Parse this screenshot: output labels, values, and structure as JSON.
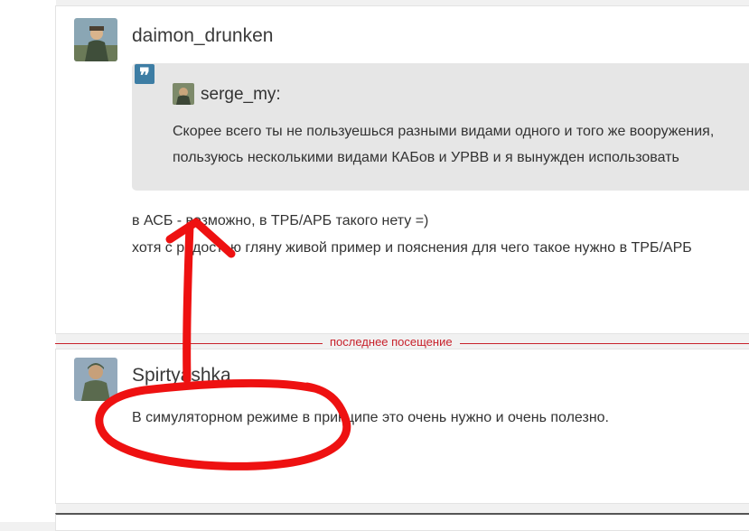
{
  "posts": [
    {
      "author": "daimon_drunken",
      "quote": {
        "author": "serge_my:",
        "lines": [
          "Скорее всего ты не пользуешься разными видами одного и того же вооружения,",
          "пользуюсь несколькими видами КАБов и УРВВ и я вынужден использовать"
        ]
      },
      "lines": [
        "в АСБ - возможно, в ТРБ/АРБ такого нету =)",
        "хотя с радостью гляну живой пример и пояснения для чего такое нужно в ТРБ/АРБ"
      ]
    },
    {
      "author": "Spirtyashka",
      "lines": [
        "В симуляторном режиме в принципе это очень нужно и очень полезно."
      ]
    }
  ],
  "last_visit_label": "последнее посещение",
  "colors": {
    "accent_red": "#c8222c",
    "quote_icon": "#3d7da4",
    "annotation": "#ee1111"
  },
  "icons": {
    "quote": "quote-icon"
  }
}
